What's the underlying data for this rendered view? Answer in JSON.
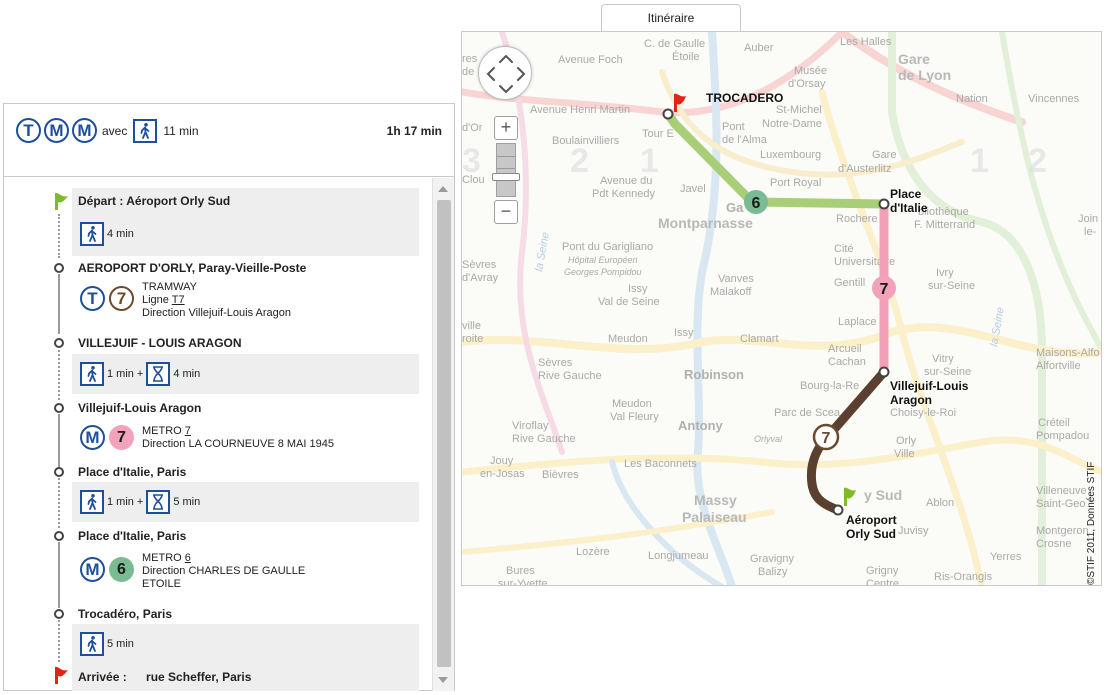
{
  "summary": {
    "modes": [
      "T",
      "M",
      "M"
    ],
    "avec": "avec",
    "walk": "11 min",
    "duration": "1h 17 min"
  },
  "steps": {
    "depart": "Départ : Aéroport Orly Sud",
    "walk1": "4 min",
    "stop1": "AEROPORT D'ORLY, Paray-Vieille-Poste",
    "tram": {
      "mode": "T",
      "line": "7",
      "type": "TRAMWAY",
      "ligne_prefix": "Ligne ",
      "ligne": "T7",
      "direction": "Direction Villejuif-Louis Aragon"
    },
    "stop2": "VILLEJUIF - LOUIS ARAGON",
    "transfer1": {
      "walk": "1 min",
      "plus": "+",
      "wait": "4 min"
    },
    "stop3": "Villejuif-Louis Aragon",
    "metro7": {
      "mode": "M",
      "line": "7",
      "type_prefix": "METRO ",
      "type_line": "7",
      "direction": "Direction LA COURNEUVE 8 MAI 1945"
    },
    "stop4": "Place d'Italie, Paris",
    "transfer2": {
      "walk": "1 min",
      "plus": "+",
      "wait": "5 min"
    },
    "stop5": "Place d'Italie, Paris",
    "metro6": {
      "mode": "M",
      "line": "6",
      "type_prefix": "METRO ",
      "type_line": "6",
      "direction1": "Direction CHARLES DE GAULLE",
      "direction2": "ETOILE"
    },
    "stop6": "Trocadéro, Paris",
    "walk2": "5 min",
    "arrivee_label": "Arrivée :",
    "arrivee_addr": "rue Scheffer, Paris"
  },
  "map": {
    "tab": "Itinéraire",
    "copyright": "©STIF 2011, Données STIF",
    "markers": {
      "trocadero": "TROCADERO",
      "italie1": "Place",
      "italie2": "d'Italie",
      "villejuif1": "Villejuif-Louis",
      "villejuif2": "Aragon",
      "orly1": "Aéroport",
      "orly2": "Orly Sud"
    },
    "badges": {
      "m6": "6",
      "m7": "7",
      "t7": "7"
    },
    "bg_labels": {
      "c_de_gaulle": "C. de Gaulle",
      "etoile": "Étoile",
      "auber": "Auber",
      "les_halles": "Les Halles",
      "gare": "Gare",
      "de_lyon": "de Lyon",
      "avenue_foch": "Avenue Foch",
      "musee": "Musée",
      "dorsay": "d'Orsay",
      "nation": "Nation",
      "vincennes": "Vincennes",
      "av_henri_martin": "Avenue Henri Martin",
      "st_michel": "St-Michel",
      "notre_dame": "Notre-Dame",
      "boulainvilliers": "Boulainvilliers",
      "tour_e": "Tour E",
      "pont": "Pont",
      "de_lalma": "de l'Alma",
      "luxembourg": "Luxembourg",
      "gare2": "Gare",
      "dausterlitz": "d'Austerlitz",
      "avenue_du": "Avenue du",
      "pdt_kennedy": "Pdt Kennedy",
      "javel": "Javel",
      "port_royal": "Port Royal",
      "montparnasse": "Montparnasse",
      "ga": "Ga",
      "rochere": "Rochere",
      "bibliotheque": "bliothèque",
      "f_mitterrand": "F. Mitterrand",
      "pont_garigliano": "Pont du Garigliano",
      "hopital": "Hôpital Européen",
      "georges_pompidou": "Georges Pompidou",
      "cite": "Cité",
      "universitaire": "Universitaire",
      "sevres": "Sèvres",
      "davray": "d'Avray",
      "issy": "Issy",
      "val_de_seine": "Val de Seine",
      "vanves": "Vanves",
      "malakoff": "Malakoff",
      "gentilly": "Gentill",
      "ivry": "Ivry",
      "sur_seine": "sur-Seine",
      "laplace": "Laplace",
      "meudon": "Meudon",
      "issy2": "Issy",
      "clamart": "Clamart",
      "arcueil": "Arcueil",
      "cachan": "Cachan",
      "vitry": "Vitry",
      "sur_seine2": "sur-Seine",
      "sevres2": "Sèvres",
      "rive_gauche": "Rive Gauche",
      "robinson": "Robinson",
      "bourg_la_reine": "Bourg-la-Re",
      "maisons_alfort": "Maisons-Alfo",
      "alfortville": "Alfortville",
      "meudon2": "Meudon",
      "val_fleury": "Val Fleury",
      "viroflay": "Viroflay",
      "rive_gauche2": "Rive Gauche",
      "antony": "Antony",
      "parc_de_sceaux": "Parc de Scea",
      "orlyval": "Orlyval",
      "choisy": "Choisy-le-Roi",
      "creteil": "Créteil",
      "pompadour": "Pompadou",
      "orly": "Orly",
      "ville": "Ville",
      "jouy": "Jouy",
      "en_josas": "en-Josas",
      "bievres": "Bièvres",
      "les_baconnets": "Les Baconnets",
      "massy": "Massy",
      "palaiseau": "Palaiseau",
      "orly_sud_bg": "y Sud",
      "ablon": "Ablon",
      "villeneuve": "Villeneuve",
      "saint_geo": "Saint-Geo",
      "montgeron": "Montgeron",
      "crosne": "Crosne",
      "juvisy": "Juvisy",
      "lozere": "Lozère",
      "longjumeau": "Longjumeau",
      "gravigny": "Gravigny",
      "balizy": "Balizy",
      "grigny": "Grigny",
      "centre": "Centre",
      "ris_orangis": "Ris-Orangis",
      "yerres": "Yerres",
      "bures": "Bures",
      "sur_yvette": "sur-Yvette",
      "res": "res",
      "de": "de",
      "dor": "d'Or",
      "clou": "Clou",
      "ville_left": "ville",
      "droite": "roite",
      "join": "Join",
      "le": "le-",
      "la_seine_1": "la Seine",
      "la_seine_2": "la Seine",
      "zone2_a": "2",
      "zone1_a": "1",
      "zone1_b": "1",
      "zone2_b": "2",
      "zone3": "3"
    }
  },
  "colors": {
    "line6": "#79bb92",
    "line7": "#f2a3bb",
    "tram7": "#6b4a2e",
    "route6": "#a8cf77",
    "route7": "#f29fb8",
    "routeT7": "#5b4030",
    "modeBlue": "#1f4f9c",
    "flagGreen": "#7fba2a",
    "flagRed": "#e2231a"
  }
}
